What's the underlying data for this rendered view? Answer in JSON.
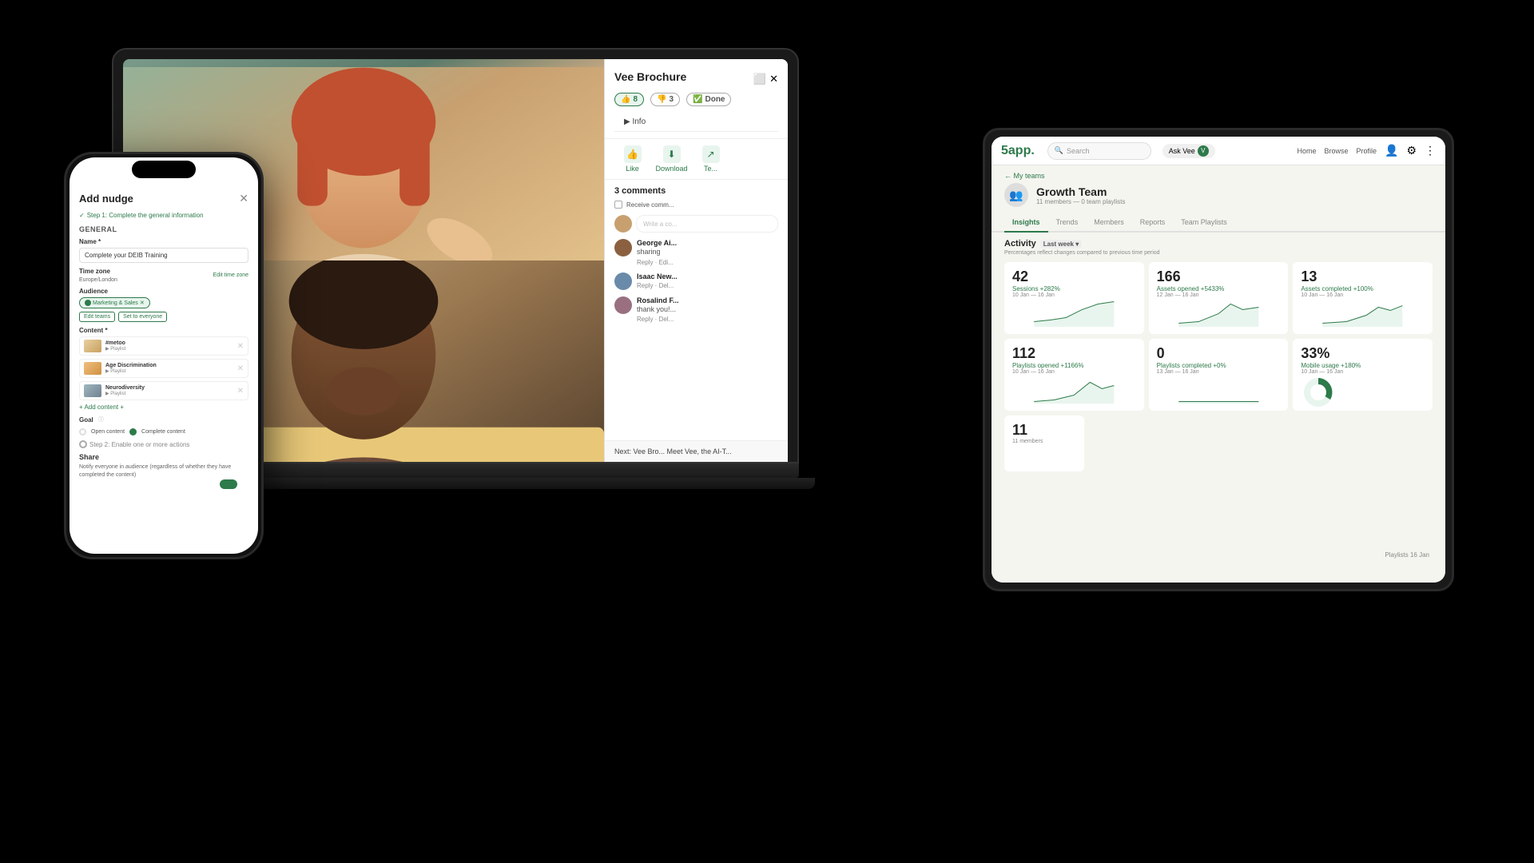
{
  "page": {
    "background": "#000"
  },
  "laptop": {
    "panel": {
      "title": "Vee Brochure",
      "likes": "8",
      "dislikes": "3",
      "done_label": "Done",
      "info_label": "▶ Info",
      "download_label": "Download",
      "comments_title": "3 comments",
      "receive_comments": "Receive comm...",
      "write_comment": "Write a co...",
      "comments": [
        {
          "name": "George Ai... sharing",
          "text": "",
          "actions": "Reply · Edi..."
        },
        {
          "name": "Isaac New...",
          "text": "",
          "actions": "Reply · Del..."
        },
        {
          "name": "Rosalind F...",
          "text": "thank you!...",
          "actions": "Reply · Del..."
        }
      ],
      "next_label": "Next: Vee Bro... Meet Vee, the AI-T..."
    }
  },
  "phone": {
    "title": "Add nudge",
    "step1": "Step 1: Complete the general information",
    "step2": "Step 2: Enable one or more actions",
    "general_label": "General",
    "name_label": "Name *",
    "name_value": "Complete your DEIB Training",
    "timezone_label": "Time zone",
    "timezone_value": "Europe/London",
    "edit_timezone": "Edit time zone",
    "audience_label": "Audience",
    "audience_chip": "Marketing & Sales",
    "edit_teams": "Edit teams",
    "set_to_everyone": "Set to everyone",
    "content_label": "Content *",
    "content_items": [
      {
        "name": "#metoo",
        "type": "Playlist"
      },
      {
        "name": "Age Discrimination",
        "type": "Playlist"
      },
      {
        "name": "Neurodiversity",
        "type": "Playlist"
      }
    ],
    "add_content": "+ Add content +",
    "goal_label": "Goal",
    "goal_open": "Open content",
    "goal_complete": "Complete content",
    "share_label": "Share",
    "share_text": "Notify everyone in audience (regardless of whether they have completed the content)"
  },
  "tablet": {
    "logo": "5app.",
    "search_placeholder": "Search",
    "ask_vee": "Ask Vee",
    "nav_home": "Home",
    "nav_browse": "Browse",
    "nav_profile": "Profile",
    "breadcrumb": "← My teams",
    "team_name": "Growth Team",
    "team_meta": "11 members — 0 team playlists",
    "tabs": [
      "Insights",
      "Trends",
      "Members",
      "Reports",
      "Team Playlists"
    ],
    "active_tab": "Insights",
    "activity_title": "Activity",
    "period": "Last week ▾",
    "activity_note": "Percentages reflect changes compared to previous time period",
    "stats": [
      {
        "value": "42",
        "label": "Sessions",
        "change": "+282%",
        "period": "10 Jan — 16 Jan"
      },
      {
        "value": "166",
        "label": "Assets opened",
        "change": "+5433%",
        "period": "12 Jan — 16 Jan"
      },
      {
        "value": "13",
        "label": "Assets completed",
        "change": "+100%",
        "period": "10 Jan — 16 Jan"
      },
      {
        "value": "112",
        "label": "Playlists opened",
        "change": "+1166%",
        "period": "10 Jan — 16 Jan"
      },
      {
        "value": "0",
        "label": "Playlists completed",
        "change": "+0%",
        "period": "13 Jan — 16 Jan"
      },
      {
        "value": "33%",
        "label": "Mobile usage",
        "change": "+180%",
        "period": "10 Jan — 16 Jan"
      }
    ],
    "members": {
      "value": "11",
      "label": "11 members"
    },
    "playlists_label": "Playlists 16 Jan"
  }
}
